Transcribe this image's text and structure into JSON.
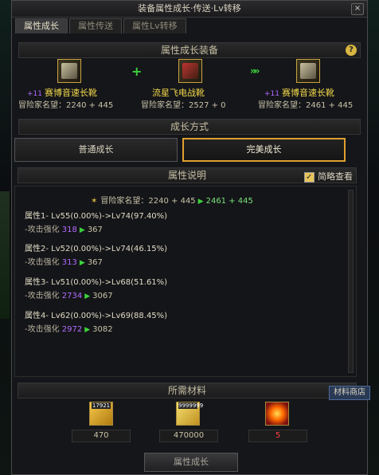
{
  "window": {
    "title": "装备属性成长·传送·Lv转移",
    "close_label": "×"
  },
  "tabs": [
    {
      "label": "属性成长",
      "active": true
    },
    {
      "label": "属性传送",
      "active": false
    },
    {
      "label": "属性Lv转移",
      "active": false
    }
  ],
  "equip_section": {
    "header": "属性成长装备",
    "help_label": "?",
    "plus_label": "+",
    "arrow_label": "»»",
    "left": {
      "plus": "+11",
      "name": "赛博音速长靴",
      "fame": "冒险家名望：2240 + 445",
      "icon": "boots-icon"
    },
    "center": {
      "name": "流星飞电战靴",
      "fame": "冒险家名望：2527 + 0",
      "icon": "material-boots-icon"
    },
    "right": {
      "plus": "+11",
      "name": "赛博音速长靴",
      "fame": "冒险家名望：2461 + 445",
      "icon": "boots-icon"
    }
  },
  "growth_method": {
    "header": "成长方式",
    "normal_label": "普通成长",
    "perfect_label": "完美成长",
    "selected": "完美成长"
  },
  "attribute_desc": {
    "header": "属性说明",
    "brief_view_label": "简略查看",
    "brief_view_checked": true,
    "fame": {
      "label": "冒险家名望：2240 + 445",
      "new": "2461 + 445"
    },
    "attributes": [
      {
        "head": "属性1- Lv55(0.00%)->Lv74(97.40%)",
        "sub_label": "-攻击强化",
        "old": "318",
        "new": "367"
      },
      {
        "head": "属性2- Lv52(0.00%)->Lv74(46.15%)",
        "sub_label": "-攻击强化",
        "old": "313",
        "new": "367"
      },
      {
        "head": "属性3- Lv51(0.00%)->Lv68(51.61%)",
        "sub_label": "-攻击强化",
        "old": "2734",
        "new": "3067"
      },
      {
        "head": "属性4- Lv62(0.00%)->Lv69(88.45%)",
        "sub_label": "-攻击强化",
        "old": "2972",
        "new": "3082"
      }
    ]
  },
  "materials": {
    "header": "所需材料",
    "shop_label": "材料商店",
    "items": [
      {
        "icon": "gem-icon",
        "stock": "17921",
        "amount": "470",
        "sufficient": true
      },
      {
        "icon": "gold-coin-icon",
        "stock": "9999999",
        "amount": "470000",
        "sufficient": true
      },
      {
        "icon": "orb-icon",
        "stock": "",
        "amount": "5",
        "sufficient": false
      }
    ]
  },
  "action": {
    "grow_label": "属性成长"
  },
  "colors": {
    "gold": "#f2d84a",
    "green": "#3cd23c",
    "purple": "#b06bff",
    "red": "#ff4040",
    "orange": "#e0a030"
  }
}
